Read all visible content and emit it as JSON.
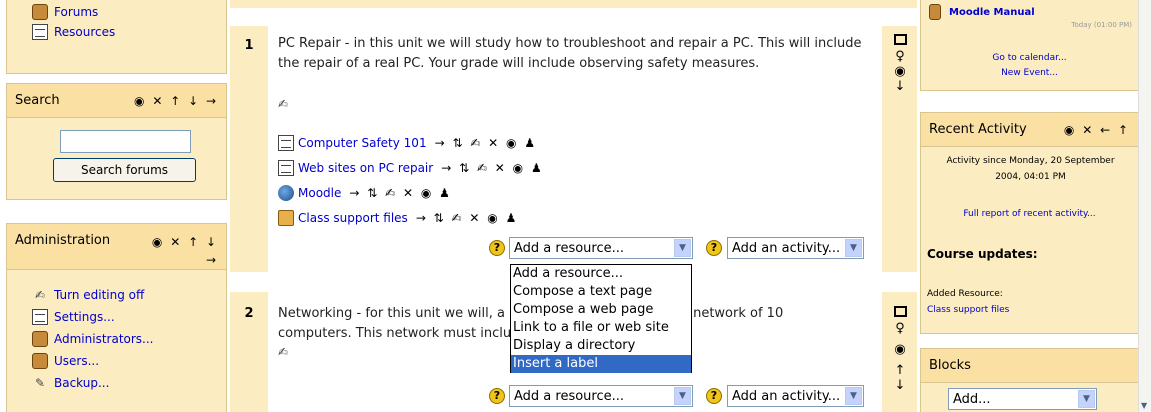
{
  "left": {
    "nav_top": [
      {
        "icon": "folder-icon",
        "label": "Forums"
      },
      {
        "icon": "document-icon",
        "label": "Resources"
      }
    ],
    "search": {
      "title": "Search",
      "head_icons": "◉ ✕ ↑ ↓ →",
      "button": "Search forums"
    },
    "admin": {
      "title": "Administration",
      "head_icons": "◉ ✕ ↑ ↓",
      "head_icons_2": "→",
      "items": [
        {
          "icon": "pen-icon",
          "label": "Turn editing off"
        },
        {
          "icon": "settings-icon",
          "label": "Settings..."
        },
        {
          "icon": "people-icon",
          "label": "Administrators..."
        },
        {
          "icon": "people-icon",
          "label": "Users..."
        },
        {
          "icon": "backup-icon",
          "label": "Backup..."
        }
      ]
    }
  },
  "topics": [
    {
      "number": "1",
      "summary": "PC Repair - in this unit we will study how to troubleshoot and repair a PC. This will include the repair of a real PC. Your grade will include observing safety measures.",
      "resources": [
        {
          "icon": "document-icon",
          "label": "Computer Safety 101",
          "actions": "→ ⇅ ✍ ✕ ◉ ♟"
        },
        {
          "icon": "document-icon",
          "label": "Web sites on PC repair",
          "actions": "→ ⇅ ✍ ✕ ◉ ♟"
        },
        {
          "icon": "globe-icon",
          "label": "Moodle",
          "actions": "→ ⇅ ✍ ✕ ◉ ♟"
        },
        {
          "icon": "folder-icon",
          "label": "Class support files",
          "actions": "→ ⇅ ✍ ✕ ◉ ♟"
        }
      ],
      "add_resource": "Add a resource...",
      "add_activity": "Add an activity..."
    },
    {
      "number": "2",
      "summary_a": "Networking - for this unit we will, a",
      "summary_b": "a network of 10",
      "summary_c": "computers. This network must inclu",
      "add_resource": "Add a resource...",
      "add_activity": "Add an activity..."
    }
  ],
  "dropdown": {
    "options": [
      "Add a resource...",
      "Compose a text page",
      "Compose a web page",
      "Link to a file or web site",
      "Display a directory",
      "Insert a label"
    ],
    "selected_index": 5
  },
  "right": {
    "calendar": {
      "manual": "Moodle Manual",
      "time": "Today (01:00 PM)",
      "goto": "Go to calendar...",
      "new_event": "New Event..."
    },
    "recent": {
      "title": "Recent Activity",
      "head_icons": "◉ ✕ ← ↑",
      "since": "Activity since Monday, 20 September 2004, 04:01 PM",
      "full_report": "Full report of recent activity...",
      "course_updates": "Course updates:",
      "added": "Added Resource:",
      "added_item": "Class support files"
    },
    "blocks": {
      "title": "Blocks",
      "select": "Add..."
    }
  },
  "colors": {
    "block_bg": "#fcecc2",
    "block_head": "#fbe0a3",
    "link": "#0000cc",
    "selection": "#316ac5"
  }
}
